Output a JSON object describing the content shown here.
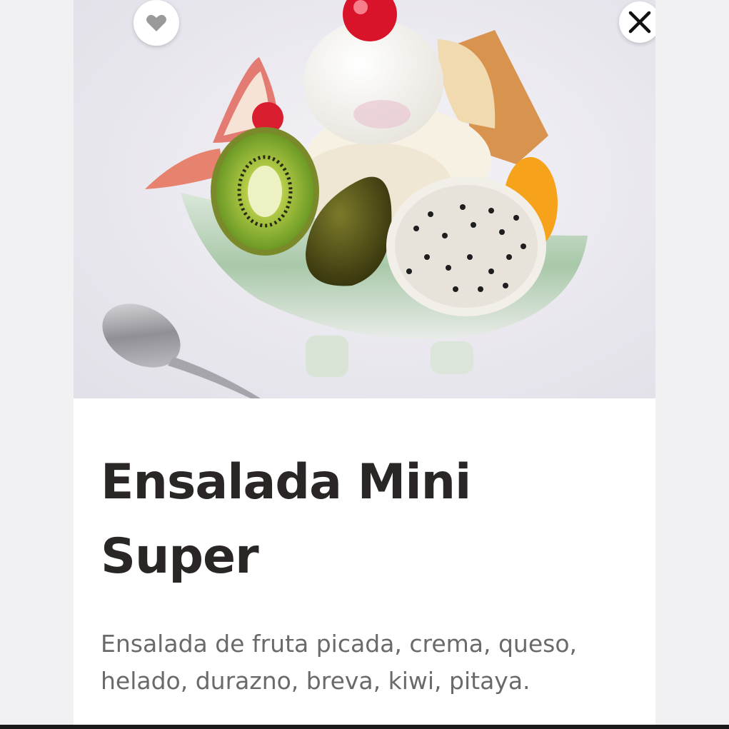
{
  "product": {
    "title": "Ensalada Mini Super",
    "description": "Ensalada de fruta picada, crema, queso, helado, durazno, breva, kiwi, pitaya."
  },
  "actions": {
    "favorite_icon": "heart-icon",
    "close_icon": "close-icon"
  },
  "colors": {
    "page_background": "#f1f1f3",
    "card_background": "#ffffff",
    "title_color": "#2a2626",
    "description_color": "#6a6a6a",
    "icon_gray": "#9a9a9a"
  }
}
